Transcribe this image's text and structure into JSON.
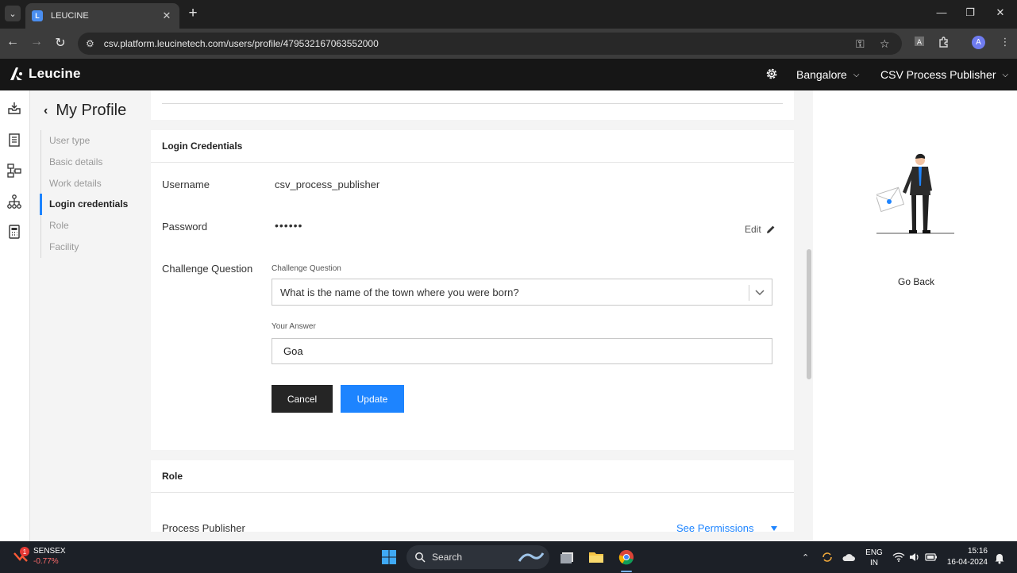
{
  "browser": {
    "tab_title": "LEUCINE",
    "url": "csv.platform.leucinetech.com/users/profile/479532167063552000"
  },
  "app": {
    "brand": "Leucine",
    "facility": "Bangalore",
    "user": "CSV Process Publisher"
  },
  "profile": {
    "title": "My Profile",
    "steps": [
      "User type",
      "Basic details",
      "Work details",
      "Login credentials",
      "Role",
      "Facility"
    ],
    "active_step": "Login credentials"
  },
  "credentials": {
    "section_title": "Login Credentials",
    "username_label": "Username",
    "username_value": "csv_process_publisher",
    "password_label": "Password",
    "password_value": "••••••",
    "edit_label": "Edit",
    "challenge_label": "Challenge Question",
    "challenge_field_label": "Challenge Question",
    "challenge_selected": "What is the name of the town where you were born?",
    "answer_label": "Your Answer",
    "answer_value": "Goa",
    "cancel_label": "Cancel",
    "update_label": "Update"
  },
  "role": {
    "section_title": "Role",
    "role_name": "Process Publisher",
    "see_permissions": "See Permissions"
  },
  "right_panel": {
    "go_back": "Go Back"
  },
  "taskbar": {
    "ticker_name": "SENSEX",
    "ticker_change": "-0.77%",
    "ticker_badge": "1",
    "search_label": "Search",
    "lang_top": "ENG",
    "lang_bottom": "IN",
    "time": "15:16",
    "date": "16-04-2024"
  },
  "colors": {
    "accent": "#1d84ff",
    "header_bg": "#161616",
    "cancel_bg": "#252525"
  }
}
